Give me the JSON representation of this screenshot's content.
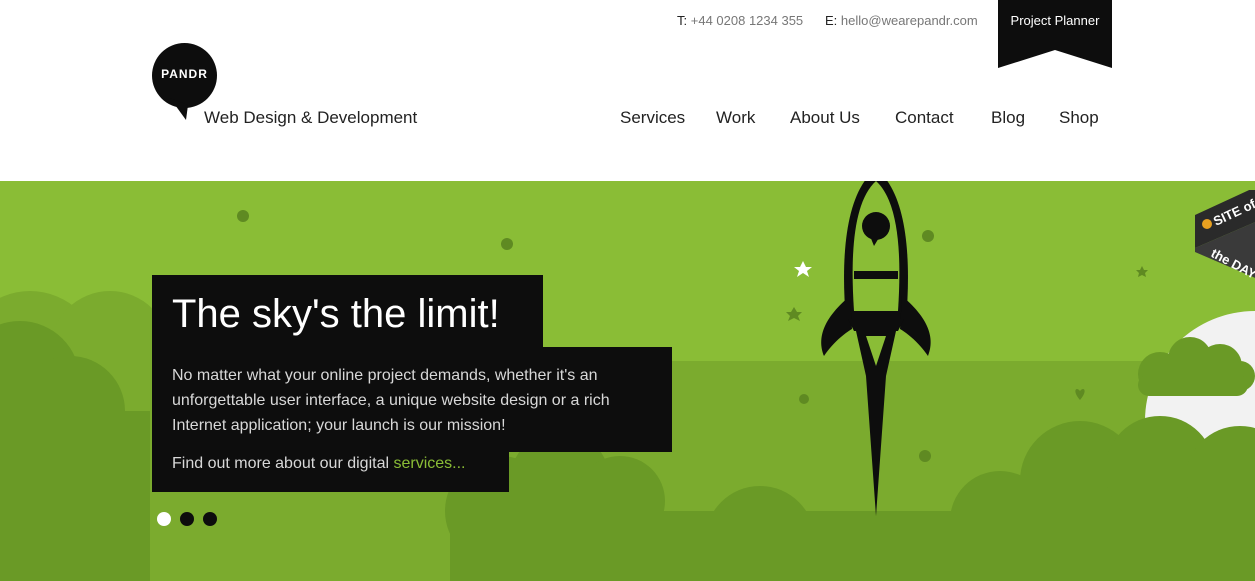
{
  "header": {
    "phone_prefix": "T:",
    "phone": "+44 0208 1234 355",
    "email_prefix": "E:",
    "email": "hello@wearepandr.com",
    "planner_label": "Project Planner",
    "logo_text": "PANDR",
    "tagline": "Web Design & Development"
  },
  "nav": {
    "items": [
      {
        "label": "Services"
      },
      {
        "label": "Work"
      },
      {
        "label": "About Us"
      },
      {
        "label": "Contact"
      },
      {
        "label": "Blog"
      },
      {
        "label": "Shop"
      }
    ]
  },
  "hero": {
    "heading": "The sky's the limit!",
    "body": "No matter what your online project demands, whether it's an unforgettable user interface, a unique website design or a rich Internet application; your launch is our mission!",
    "cta_prefix": "Find out more about our digital ",
    "cta_link": "services...",
    "slides": {
      "count": 3,
      "active": 1
    }
  },
  "badge": {
    "line1": "SITE of",
    "line2": "the DAY"
  },
  "colors": {
    "green": "#8abd36",
    "dark_green": "#6a9a26",
    "black": "#0d0d0d",
    "white": "#ffffff"
  },
  "icons": [
    "logo-speech-bubble-icon",
    "rocket-icon",
    "flower-icon",
    "star-icon",
    "heart-icon",
    "moon-icon"
  ]
}
